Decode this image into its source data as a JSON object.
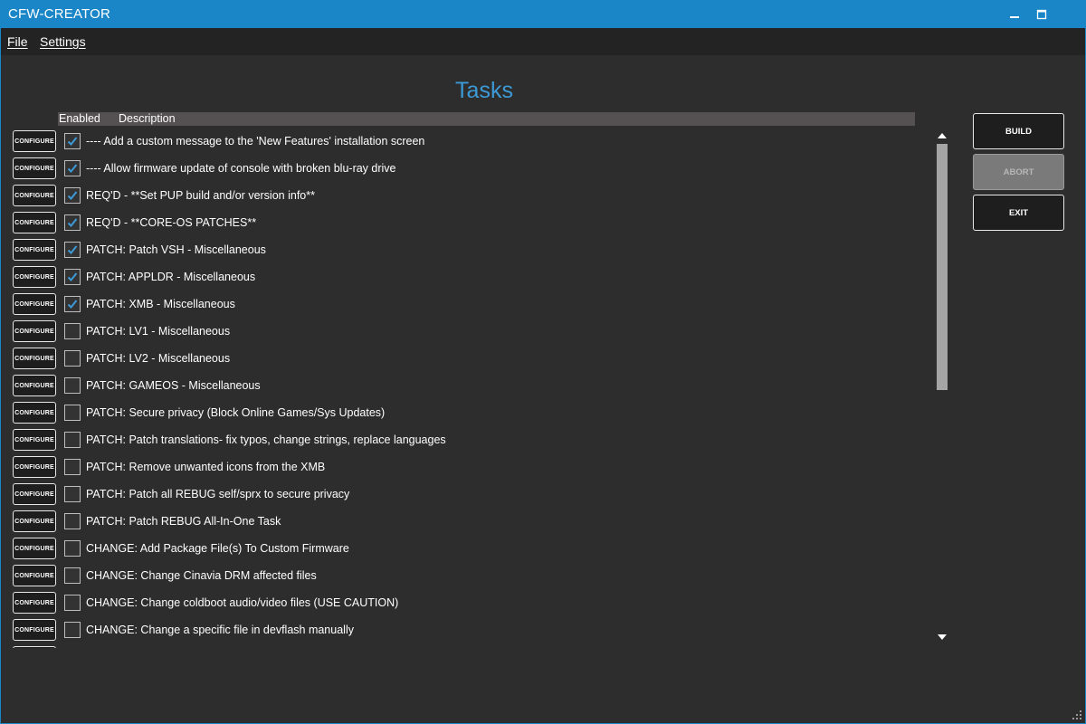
{
  "window": {
    "title": "CFW-CREATOR",
    "accent_color": "#1a86c8",
    "controls": {
      "minimize_icon": "minimize-icon",
      "maximize_icon": "maximize-icon"
    }
  },
  "menu": {
    "file": "File",
    "settings": "Settings"
  },
  "page": {
    "title": "Tasks",
    "title_color": "#3c9ad7"
  },
  "table": {
    "headers": {
      "enabled": "Enabled",
      "description": "Description"
    },
    "configure_label": "CONFIGURE",
    "rows": [
      {
        "enabled": true,
        "description": "---- Add a custom message to the 'New Features' installation screen"
      },
      {
        "enabled": true,
        "description": "---- Allow firmware update of console with broken blu-ray drive"
      },
      {
        "enabled": true,
        "description": "REQ'D - **Set PUP build and/or version info**"
      },
      {
        "enabled": true,
        "description": "REQ'D - **CORE-OS PATCHES**"
      },
      {
        "enabled": true,
        "description": "PATCH: Patch VSH - Miscellaneous"
      },
      {
        "enabled": true,
        "description": "PATCH: APPLDR - Miscellaneous"
      },
      {
        "enabled": true,
        "description": "PATCH: XMB - Miscellaneous"
      },
      {
        "enabled": false,
        "description": "PATCH: LV1 - Miscellaneous"
      },
      {
        "enabled": false,
        "description": "PATCH: LV2 - Miscellaneous"
      },
      {
        "enabled": false,
        "description": "PATCH: GAMEOS - Miscellaneous"
      },
      {
        "enabled": false,
        "description": "PATCH: Secure privacy (Block Online Games/Sys Updates)"
      },
      {
        "enabled": false,
        "description": "PATCH: Patch translations- fix typos, change strings, replace languages"
      },
      {
        "enabled": false,
        "description": "PATCH: Remove unwanted icons from the XMB"
      },
      {
        "enabled": false,
        "description": "PATCH: Patch all REBUG self/sprx to secure privacy"
      },
      {
        "enabled": false,
        "description": "PATCH: Patch REBUG All-In-One Task"
      },
      {
        "enabled": false,
        "description": "CHANGE: Add Package File(s) To Custom Firmware"
      },
      {
        "enabled": false,
        "description": "CHANGE: Change Cinavia DRM affected files"
      },
      {
        "enabled": false,
        "description": "CHANGE: Change coldboot audio/video files (USE CAUTION)"
      },
      {
        "enabled": false,
        "description": "CHANGE: Change a specific file in devflash manually"
      },
      {
        "enabled": false,
        "description": ""
      }
    ]
  },
  "actions": {
    "build": "BUILD",
    "abort": "ABORT",
    "exit": "EXIT"
  }
}
